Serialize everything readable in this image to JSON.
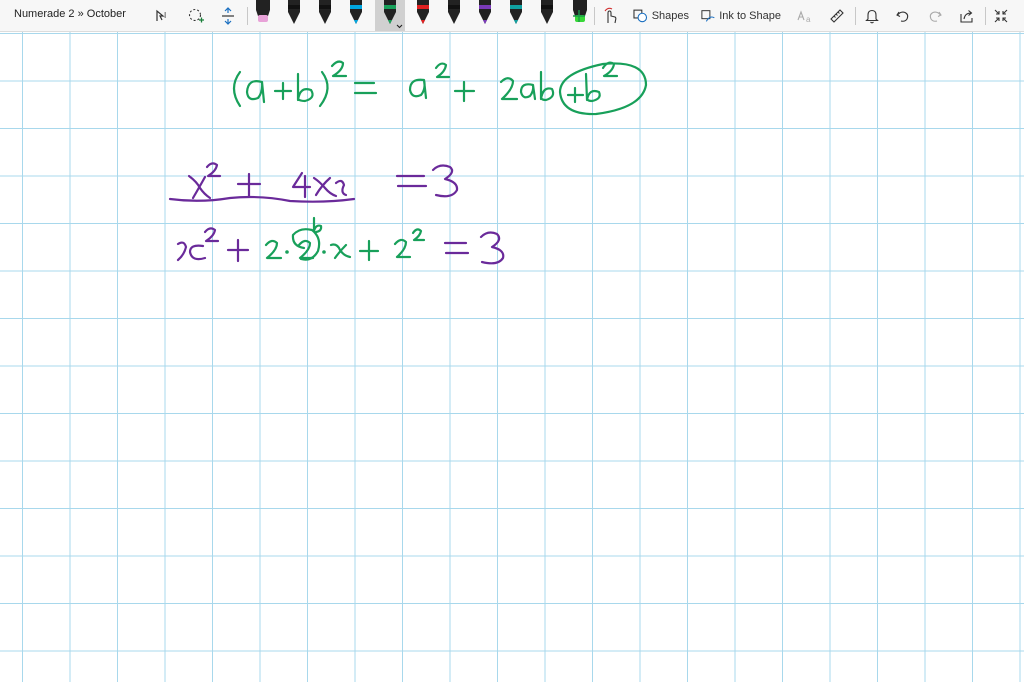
{
  "toolbar": {
    "breadcrumb": "Numerade 2 » October",
    "shapes_label": "Shapes",
    "ink_to_shape_label": "Ink to Shape",
    "icons": [
      "lasso-select-icon",
      "add-space-icon",
      "move-icon",
      "touch-draw-icon",
      "ink-to-text-icon",
      "ruler-icon",
      "bell-icon",
      "undo-icon",
      "redo-icon",
      "share-icon",
      "exit-fullscreen-icon"
    ],
    "pens": [
      {
        "name": "pink-highlighter",
        "color": "#e8a2d8"
      },
      {
        "name": "black-pen-1",
        "color": "#111111"
      },
      {
        "name": "black-pen-2",
        "color": "#111111"
      },
      {
        "name": "blue-pen",
        "color": "#00a6e0"
      },
      {
        "name": "green-pen",
        "color": "#18a05a",
        "selected": true
      },
      {
        "name": "red-pen",
        "color": "#e02020"
      },
      {
        "name": "black-pen-3",
        "color": "#111111"
      },
      {
        "name": "purple-pen",
        "color": "#7a3ab8"
      },
      {
        "name": "teal-pen",
        "color": "#10a0a0"
      },
      {
        "name": "black-pen-4",
        "color": "#111111"
      },
      {
        "name": "green-highlighter",
        "color": "#38d838"
      }
    ]
  },
  "ink_colors": {
    "green": "#18a05a",
    "purple": "#6a2a9a"
  }
}
